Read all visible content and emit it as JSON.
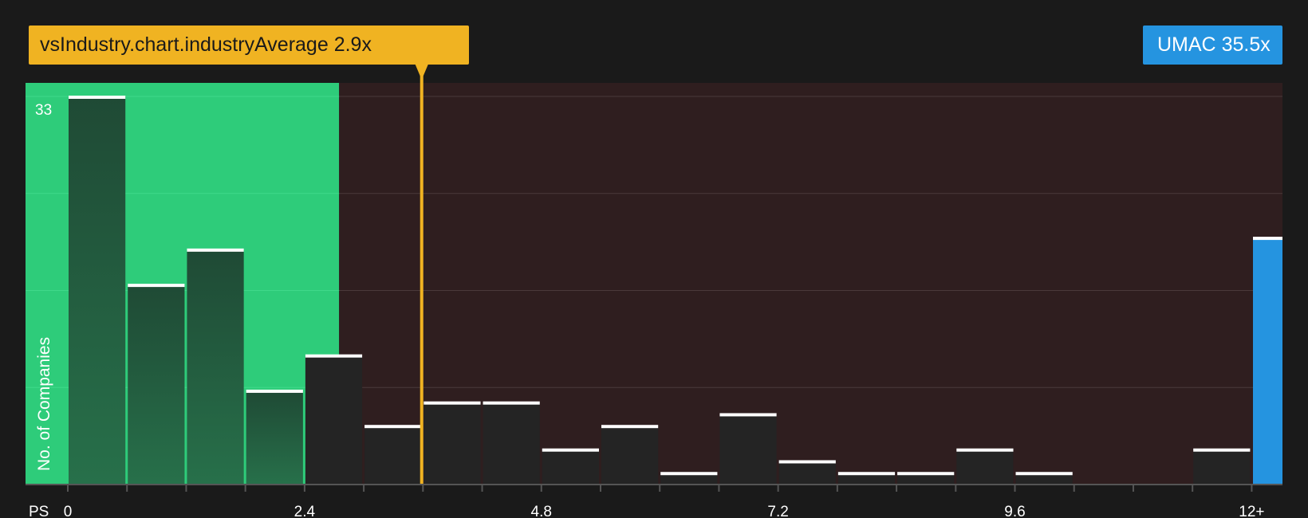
{
  "industry_callout": {
    "label": "vsIndustry.chart.industryAverage",
    "value": "2.9x"
  },
  "company_callout": {
    "label": "UMAC",
    "value": "35.5x"
  },
  "colors": {
    "background": "#1a1a1a",
    "fair_zone": "#2ecc7a",
    "over_zone": "#2f1e1f",
    "industry_line": "#f0b322",
    "company_bar": "#2594e0",
    "bar_dark": "#242424",
    "bar_cap": "#ffffff"
  },
  "chart_data": {
    "type": "bar",
    "xlabel": "PS",
    "ylabel": "No. of Companies",
    "xlim": [
      0,
      12.3
    ],
    "ylim": [
      0,
      33
    ],
    "bin_width": 0.6,
    "x_ticks": [
      0,
      2.4,
      4.8,
      7.2,
      9.6,
      12
    ],
    "x_tick_labels": [
      "0",
      "2.4",
      "4.8",
      "7.2",
      "9.6",
      "12+"
    ],
    "y_max_label": "33",
    "bins": [
      {
        "start": 0.0,
        "value": 33
      },
      {
        "start": 0.6,
        "value": 17
      },
      {
        "start": 1.2,
        "value": 20
      },
      {
        "start": 1.8,
        "value": 8
      },
      {
        "start": 2.4,
        "value": 11
      },
      {
        "start": 3.0,
        "value": 5
      },
      {
        "start": 3.6,
        "value": 7
      },
      {
        "start": 4.2,
        "value": 7
      },
      {
        "start": 4.8,
        "value": 3
      },
      {
        "start": 5.4,
        "value": 5
      },
      {
        "start": 6.0,
        "value": 1
      },
      {
        "start": 6.6,
        "value": 6
      },
      {
        "start": 7.2,
        "value": 2
      },
      {
        "start": 7.8,
        "value": 1
      },
      {
        "start": 8.4,
        "value": 1
      },
      {
        "start": 9.0,
        "value": 3
      },
      {
        "start": 9.6,
        "value": 1
      },
      {
        "start": 10.2,
        "value": 0
      },
      {
        "start": 10.8,
        "value": 0
      },
      {
        "start": 11.4,
        "value": 3
      }
    ],
    "fair_zone_end": 2.75,
    "industry_average": 2.9,
    "company": {
      "name": "UMAC",
      "value": 35.5,
      "bar_height": 21
    }
  }
}
